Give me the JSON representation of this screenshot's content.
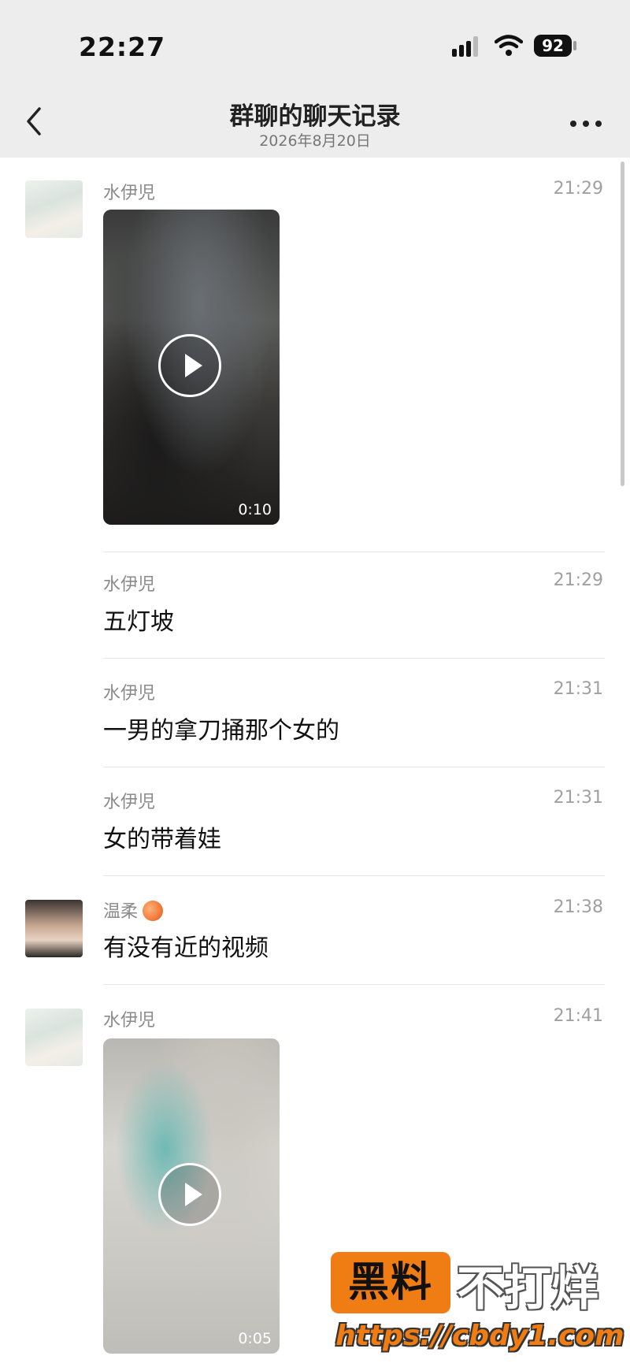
{
  "status_bar": {
    "time": "22:27",
    "battery": "92"
  },
  "nav": {
    "title": "群聊的聊天记录",
    "subtitle": "2026年8月20日"
  },
  "messages": [
    {
      "sender": "水伊児",
      "time": "21:29",
      "type": "video",
      "duration": "0:10"
    },
    {
      "sender": "水伊児",
      "time": "21:29",
      "type": "text",
      "text": "五灯坡"
    },
    {
      "sender": "水伊児",
      "time": "21:31",
      "type": "text",
      "text": "一男的拿刀捅那个女的"
    },
    {
      "sender": "水伊児",
      "time": "21:31",
      "type": "text",
      "text": "女的带着娃"
    },
    {
      "sender": "温柔",
      "sender_emoji": "peach-icon",
      "time": "21:38",
      "type": "text",
      "text": "有没有近的视频"
    },
    {
      "sender": "水伊児",
      "time": "21:41",
      "type": "video",
      "duration": "0:05"
    }
  ],
  "watermark": {
    "badge": "黑料",
    "slogan": "不打烊",
    "url": "https://cbdy1.com"
  },
  "colors": {
    "nav_bg": "#ededed",
    "watermark_orange": "#f07c14"
  }
}
